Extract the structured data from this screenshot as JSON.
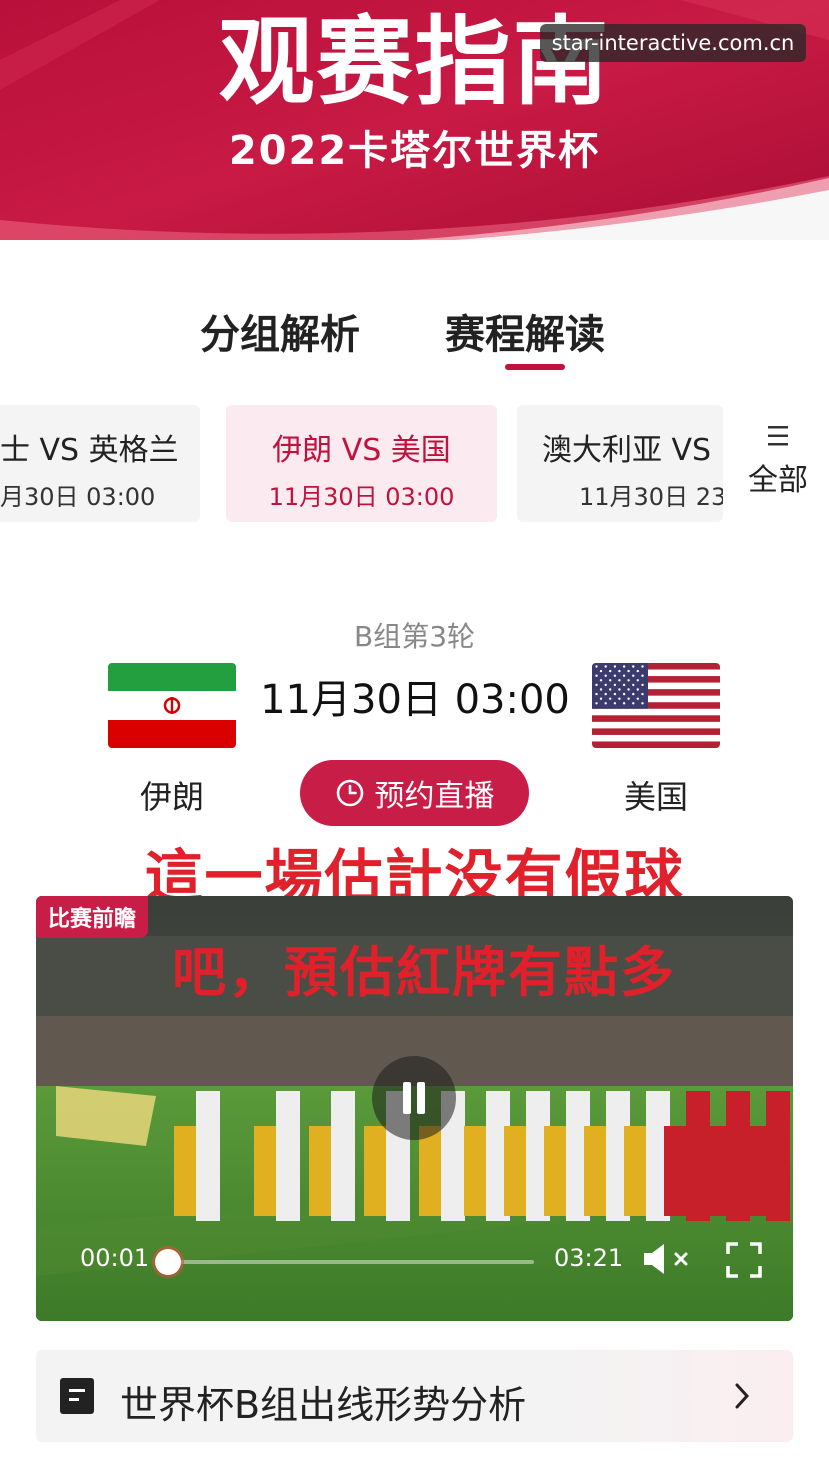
{
  "header": {
    "title": "观赛指南",
    "subtitle": "2022卡塔尔世界杯",
    "watermark": "star-interactive.com.cn",
    "colors": {
      "primary": "#c0123c",
      "secondary": "#e23a5c"
    }
  },
  "tabs": [
    {
      "label": "分组解析",
      "active": false
    },
    {
      "label": "赛程解读",
      "active": true
    }
  ],
  "matches": [
    {
      "title": "士 VS 英格兰",
      "time": "月30日 03:00",
      "active": false
    },
    {
      "title": "伊朗 VS 美国",
      "time": "11月30日 03:00",
      "active": true
    },
    {
      "title": "澳大利亚 VS",
      "time": "11月30日 23",
      "active": false
    }
  ],
  "all_button": {
    "icon": "menu-icon",
    "label": "全部"
  },
  "match_info": {
    "round": "B组第3轮",
    "datetime": "11月30日 03:00",
    "home_team": "伊朗",
    "away_team": "美国",
    "home_flag": "iran-flag-icon",
    "away_flag": "usa-flag-icon",
    "reserve_button": "预约直播"
  },
  "captions": {
    "line1": "這一場估計没有假球",
    "line2": "吧，預估紅牌有點多"
  },
  "video": {
    "tag": "比赛前瞻",
    "current_time": "00:01",
    "total_time": "03:21",
    "progress": 0.005,
    "state": "playing",
    "muted": true
  },
  "analysis": {
    "label": "世界杯B组出线形势分析"
  }
}
